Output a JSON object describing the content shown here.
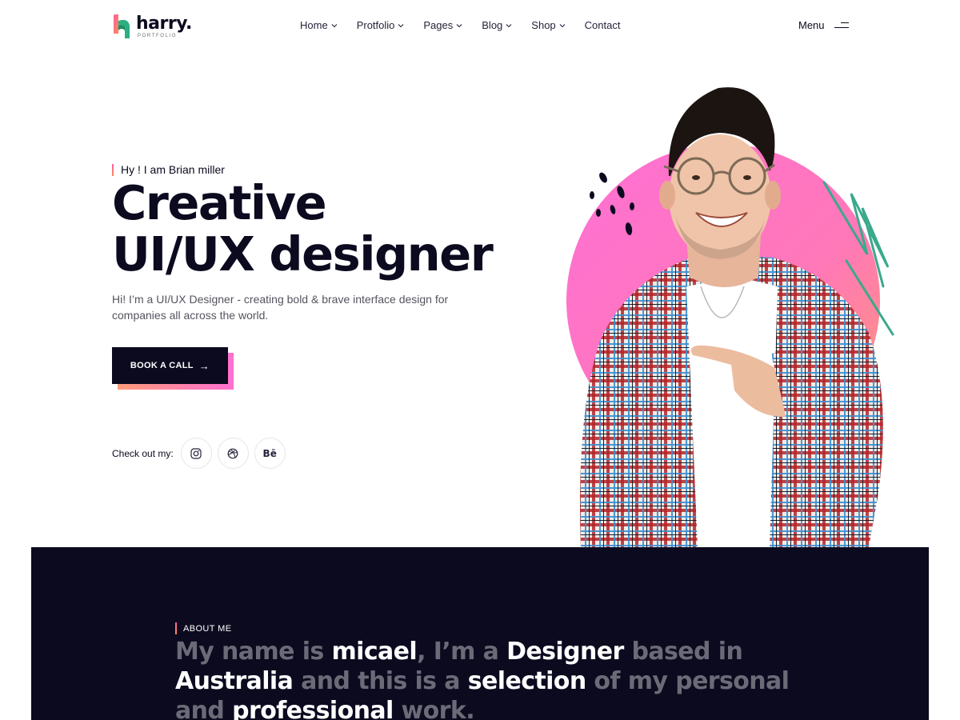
{
  "brand": {
    "name": "harry.",
    "tagline": "PORTFOLIO"
  },
  "nav": [
    {
      "label": "Home",
      "has_dropdown": true
    },
    {
      "label": "Protfolio",
      "has_dropdown": true
    },
    {
      "label": "Pages",
      "has_dropdown": true
    },
    {
      "label": "Blog",
      "has_dropdown": true
    },
    {
      "label": "Shop",
      "has_dropdown": true
    },
    {
      "label": "Contact",
      "has_dropdown": false
    }
  ],
  "menu_label": "Menu",
  "hero": {
    "greeting": "Hy ! I am Brian miller",
    "title_line1": "Creative",
    "title_line2": "UI/UX designer",
    "description": "Hi! I’m a UI/UX Designer - creating bold & brave interface design for companies all across the world.",
    "cta_label": "BOOK A CALL",
    "cta_arrow": "→",
    "socials_label": "Check out my:",
    "socials": [
      {
        "name": "instagram-icon"
      },
      {
        "name": "dribbble-icon"
      },
      {
        "name": "behance-icon",
        "glyph": "Bē"
      }
    ]
  },
  "about": {
    "label": "ABOUT ME",
    "segments": [
      {
        "text": "My name is ",
        "hl": false
      },
      {
        "text": "micael",
        "hl": true
      },
      {
        "text": ", I’m a ",
        "hl": false
      },
      {
        "text": "Designer",
        "hl": true
      },
      {
        "text": " based in ",
        "hl": false
      },
      {
        "text": "Australia",
        "hl": true
      },
      {
        "text": " and this is a ",
        "hl": false
      },
      {
        "text": "selection",
        "hl": true
      },
      {
        "text": " of my personal and ",
        "hl": false
      },
      {
        "text": "professional",
        "hl": true
      },
      {
        "text": " work.",
        "hl": false
      }
    ]
  },
  "colors": {
    "dark": "#0b0a1f",
    "accent_pink": "#ff6fd1",
    "accent_orange": "#ff9b7a",
    "accent_green": "#3aa98c"
  }
}
